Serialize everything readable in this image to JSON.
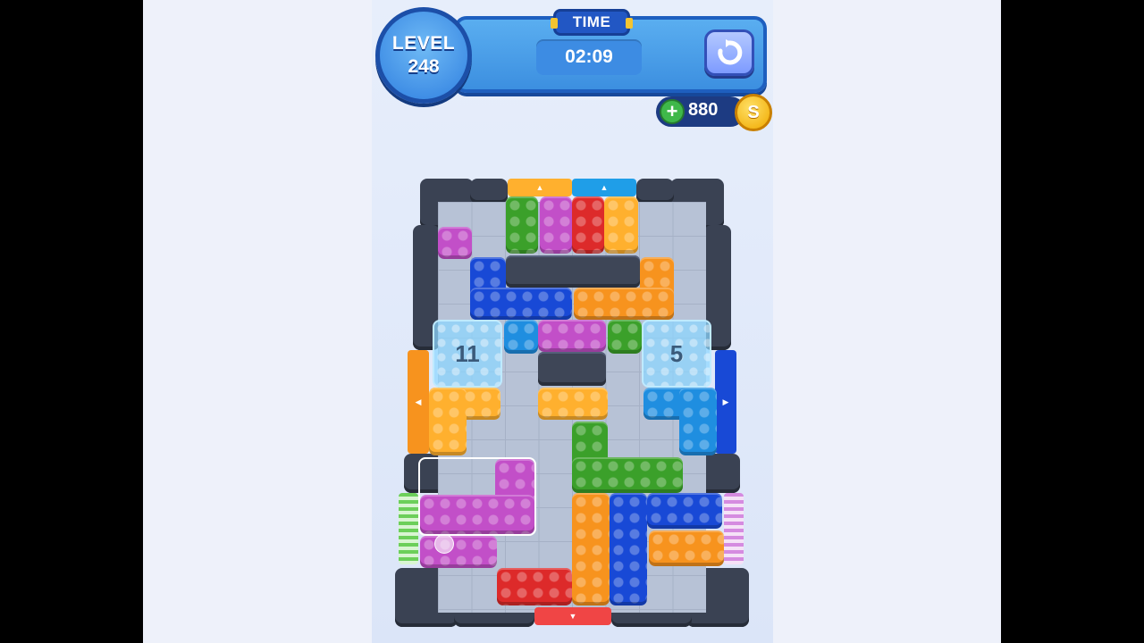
{
  "hud": {
    "level_label": "LEVEL",
    "level_number": "248",
    "time_label": "TIME",
    "timer": "02:09",
    "coins": "880",
    "coin_symbol": "S",
    "plus_symbol": "+",
    "restart_icon": "restart-icon"
  },
  "board": {
    "ice_blocks": [
      {
        "count": "11"
      },
      {
        "count": "5"
      }
    ],
    "colors": {
      "orange": "#f7931e",
      "yellow": "#ffb02e",
      "green": "#3ba02a",
      "purple": "#c24fc8",
      "red": "#dd2a2a",
      "blue": "#1849d6",
      "sky": "#1f8ee0",
      "wall": "#3e4657"
    },
    "exit_gates": [
      "yellow",
      "sky",
      "orange",
      "blue",
      "green",
      "purple",
      "red"
    ]
  }
}
